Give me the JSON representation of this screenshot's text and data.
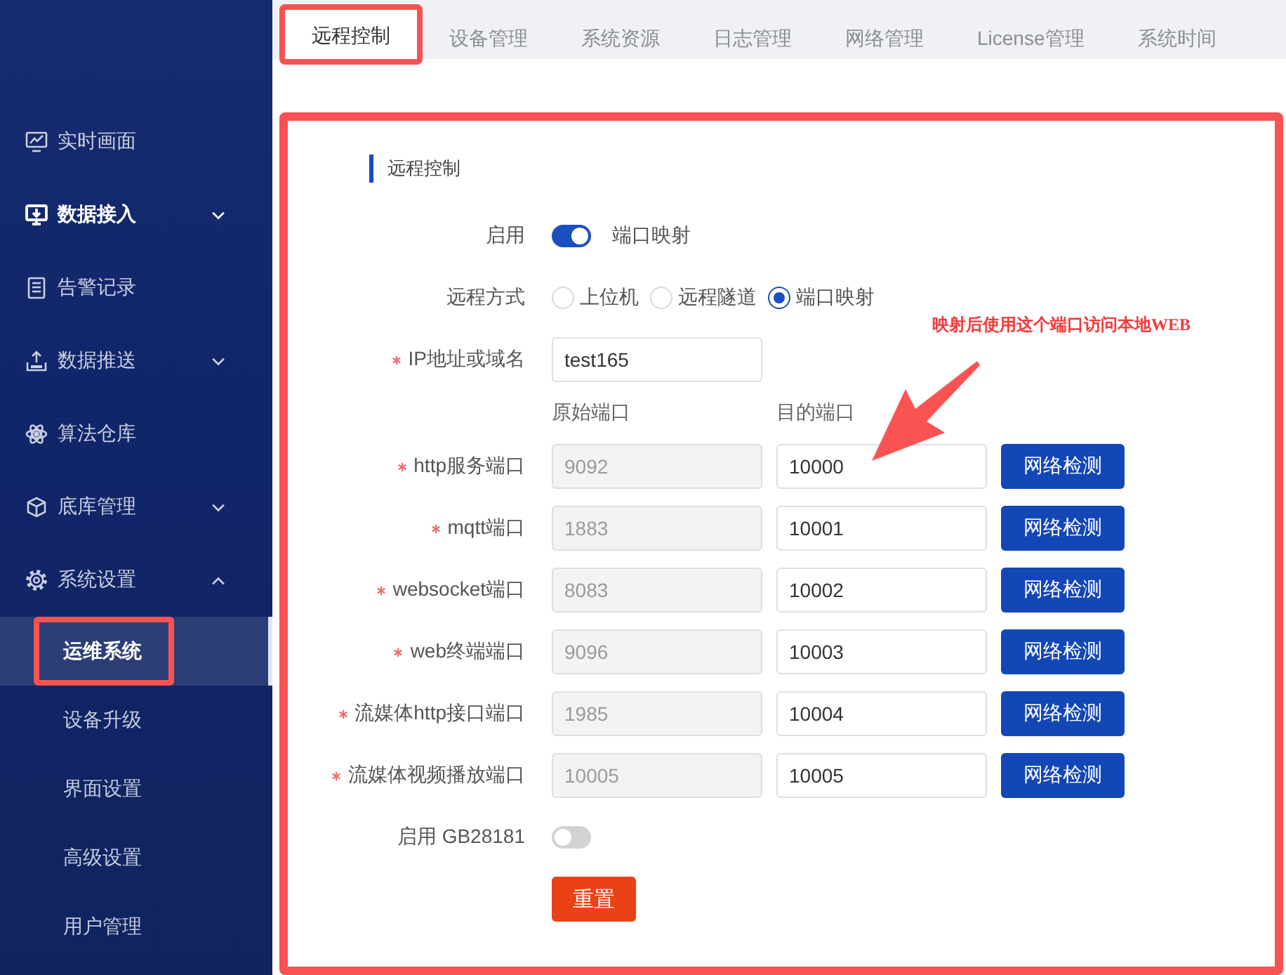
{
  "sidebar": {
    "items": [
      {
        "label": "实时画面",
        "kind": "link",
        "active": false
      },
      {
        "label": "数据接入",
        "kind": "menu",
        "active": true,
        "expanded": false
      },
      {
        "label": "告警记录",
        "kind": "link",
        "active": false
      },
      {
        "label": "数据推送",
        "kind": "menu",
        "active": false,
        "expanded": false
      },
      {
        "label": "算法仓库",
        "kind": "link",
        "active": false
      },
      {
        "label": "底库管理",
        "kind": "menu",
        "active": false,
        "expanded": false
      },
      {
        "label": "系统设置",
        "kind": "menu",
        "active": false,
        "expanded": true,
        "children": [
          {
            "label": "运维系统",
            "selected": true,
            "highlighted": true
          },
          {
            "label": "设备升级",
            "selected": false,
            "highlighted": false
          },
          {
            "label": "界面设置",
            "selected": false,
            "highlighted": false
          },
          {
            "label": "高级设置",
            "selected": false,
            "highlighted": false
          },
          {
            "label": "用户管理",
            "selected": false,
            "highlighted": false
          }
        ]
      }
    ]
  },
  "tabs": [
    {
      "label": "远程控制",
      "selected": true,
      "highlighted": true
    },
    {
      "label": "设备管理",
      "selected": false,
      "highlighted": false
    },
    {
      "label": "系统资源",
      "selected": false,
      "highlighted": false
    },
    {
      "label": "日志管理",
      "selected": false,
      "highlighted": false
    },
    {
      "label": "网络管理",
      "selected": false,
      "highlighted": false
    },
    {
      "label": "License管理",
      "selected": false,
      "highlighted": false
    },
    {
      "label": "系统时间",
      "selected": false,
      "highlighted": false
    }
  ],
  "panel": {
    "highlighted": true,
    "title": "远程控制",
    "enable": {
      "label": "启用",
      "on": true,
      "text": "端口映射"
    },
    "mode": {
      "label": "远程方式",
      "options": [
        {
          "label": "上位机",
          "selected": false
        },
        {
          "label": "远程隧道",
          "selected": false
        },
        {
          "label": "端口映射",
          "selected": true
        }
      ]
    },
    "host": {
      "label": "IP地址或域名",
      "required": true,
      "value": "test165"
    },
    "port_columns": [
      "原始端口",
      "目的端口"
    ],
    "ports": [
      {
        "label": "http服务端口",
        "required": true,
        "source": "9092",
        "source_disabled": true,
        "target": "10000",
        "button": "网络检测"
      },
      {
        "label": "mqtt端口",
        "required": true,
        "source": "1883",
        "source_disabled": true,
        "target": "10001",
        "button": "网络检测"
      },
      {
        "label": "websocket端口",
        "required": true,
        "source": "8083",
        "source_disabled": true,
        "target": "10002",
        "button": "网络检测"
      },
      {
        "label": "web终端端口",
        "required": true,
        "source": "9096",
        "source_disabled": true,
        "target": "10003",
        "button": "网络检测"
      },
      {
        "label": "流媒体http接口端口",
        "required": true,
        "source": "1985",
        "source_disabled": true,
        "target": "10004",
        "button": "网络检测"
      },
      {
        "label": "流媒体视频播放端口",
        "required": true,
        "source": "10005",
        "source_disabled": true,
        "target": "10005",
        "button": "网络检测"
      }
    ],
    "gb28181": {
      "label": "启用 GB28181",
      "on": false
    },
    "reset_button": "重置",
    "annotation": {
      "note": "映射后使用这个端口访问本地WEB"
    }
  }
}
